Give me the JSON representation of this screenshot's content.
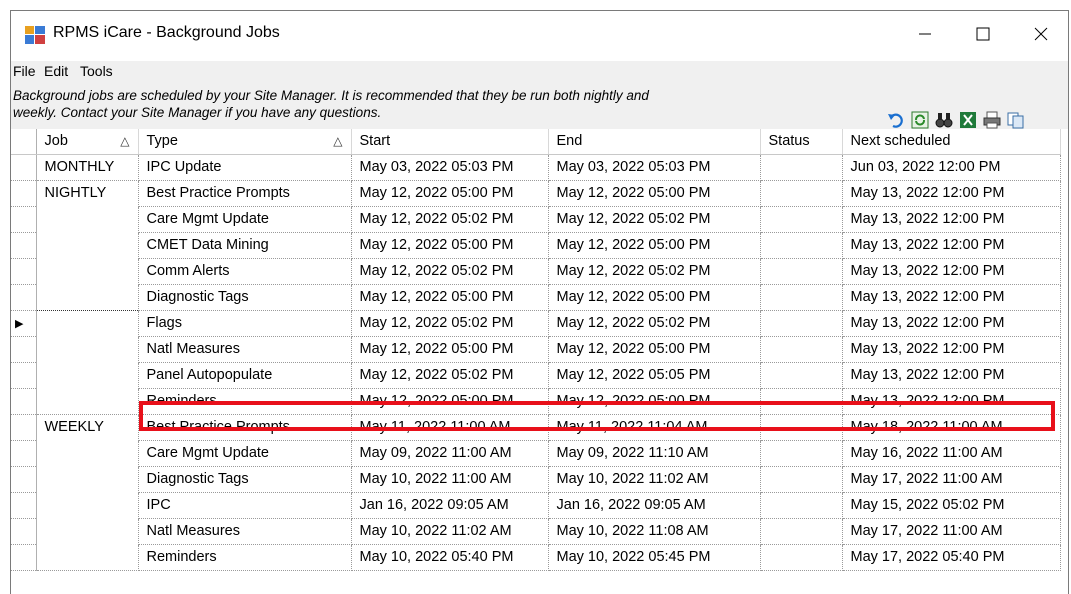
{
  "window": {
    "title": "RPMS iCare - Background Jobs",
    "controls": {
      "minimize": "—",
      "maximize": "☐",
      "close": "✕"
    }
  },
  "menu": [
    "File",
    "Edit",
    "Tools"
  ],
  "info": {
    "line1": "Background jobs are scheduled by your Site Manager.  It is recommended that they be run both nightly and",
    "line2": "weekly.  Contact your Site Manager if you have any questions."
  },
  "toolbar": [
    "undo-icon",
    "refresh-icon",
    "find-icon",
    "excel-icon",
    "print-icon",
    "copy-icon"
  ],
  "columns": {
    "job": "Job",
    "type": "Type",
    "start": "Start",
    "end": "End",
    "status": "Status",
    "next": "Next scheduled"
  },
  "rows": [
    {
      "job": "MONTHLY",
      "type": "IPC Update",
      "start": "May 03, 2022 05:03 PM",
      "end": "May 03, 2022 05:03 PM",
      "status": "",
      "next": "Jun 03, 2022 12:00 PM"
    },
    {
      "job": "NIGHTLY",
      "type": "Best Practice Prompts",
      "start": "May 12, 2022 05:00 PM",
      "end": "May 12, 2022 05:00 PM",
      "status": "",
      "next": "May 13, 2022 12:00 PM"
    },
    {
      "job": "",
      "type": "Care Mgmt Update",
      "start": "May 12, 2022 05:02 PM",
      "end": "May 12, 2022 05:02 PM",
      "status": "",
      "next": "May 13, 2022 12:00 PM"
    },
    {
      "job": "",
      "type": "CMET Data Mining",
      "start": "May 12, 2022 05:00 PM",
      "end": "May 12, 2022 05:00 PM",
      "status": "",
      "next": "May 13, 2022 12:00 PM"
    },
    {
      "job": "",
      "type": "Comm Alerts",
      "start": "May 12, 2022 05:02 PM",
      "end": "May 12, 2022 05:02 PM",
      "status": "",
      "next": "May 13, 2022 12:00 PM"
    },
    {
      "job": "",
      "type": "Diagnostic Tags",
      "start": "May 12, 2022 05:00 PM",
      "end": "May 12, 2022 05:00 PM",
      "status": "",
      "next": "May 13, 2022 12:00 PM"
    },
    {
      "job": "",
      "type": "Flags",
      "start": "May 12, 2022 05:02 PM",
      "end": "May 12, 2022 05:02 PM",
      "status": "",
      "next": "May 13, 2022 12:00 PM"
    },
    {
      "job": "",
      "type": "Natl Measures",
      "start": "May 12, 2022 05:00 PM",
      "end": "May 12, 2022 05:00 PM",
      "status": "",
      "next": "May 13, 2022 12:00 PM"
    },
    {
      "job": "",
      "type": "Panel Autopopulate",
      "start": "May 12, 2022 05:02 PM",
      "end": "May 12, 2022 05:05 PM",
      "status": "",
      "next": "May 13, 2022 12:00 PM"
    },
    {
      "job": "",
      "type": "Reminders",
      "start": "May 12, 2022 05:00 PM",
      "end": "May 12, 2022 05:00 PM",
      "status": "",
      "next": "May 13, 2022 12:00 PM"
    },
    {
      "job": "WEEKLY",
      "type": "Best Practice Prompts",
      "start": "May 11, 2022 11:00 AM",
      "end": "May 11, 2022 11:04 AM",
      "status": "",
      "next": "May 18, 2022 11:00 AM"
    },
    {
      "job": "",
      "type": "Care Mgmt Update",
      "start": "May 09, 2022 11:00 AM",
      "end": "May 09, 2022 11:10 AM",
      "status": "",
      "next": "May 16, 2022 11:00 AM"
    },
    {
      "job": "",
      "type": "Diagnostic Tags",
      "start": "May 10, 2022 11:00 AM",
      "end": "May 10, 2022 11:02 AM",
      "status": "",
      "next": "May 17, 2022 11:00 AM"
    },
    {
      "job": "",
      "type": "IPC",
      "start": "Jan 16, 2022 09:05 AM",
      "end": "Jan 16, 2022 09:05 AM",
      "status": "",
      "next": "May 15, 2022 05:02 PM"
    },
    {
      "job": "",
      "type": "Natl Measures",
      "start": "May 10, 2022 11:02 AM",
      "end": "May 10, 2022 11:08 AM",
      "status": "",
      "next": "May 17, 2022 11:00 AM"
    },
    {
      "job": "",
      "type": "Reminders",
      "start": "May 10, 2022 05:40 PM",
      "end": "May 10, 2022 05:45 PM",
      "status": "",
      "next": "May 17, 2022 05:40 PM"
    }
  ],
  "selected_row_index": 6,
  "highlighted_row_index": 4,
  "colors": {
    "highlight": "#e8101a",
    "menubar": "#f0f0f0"
  }
}
